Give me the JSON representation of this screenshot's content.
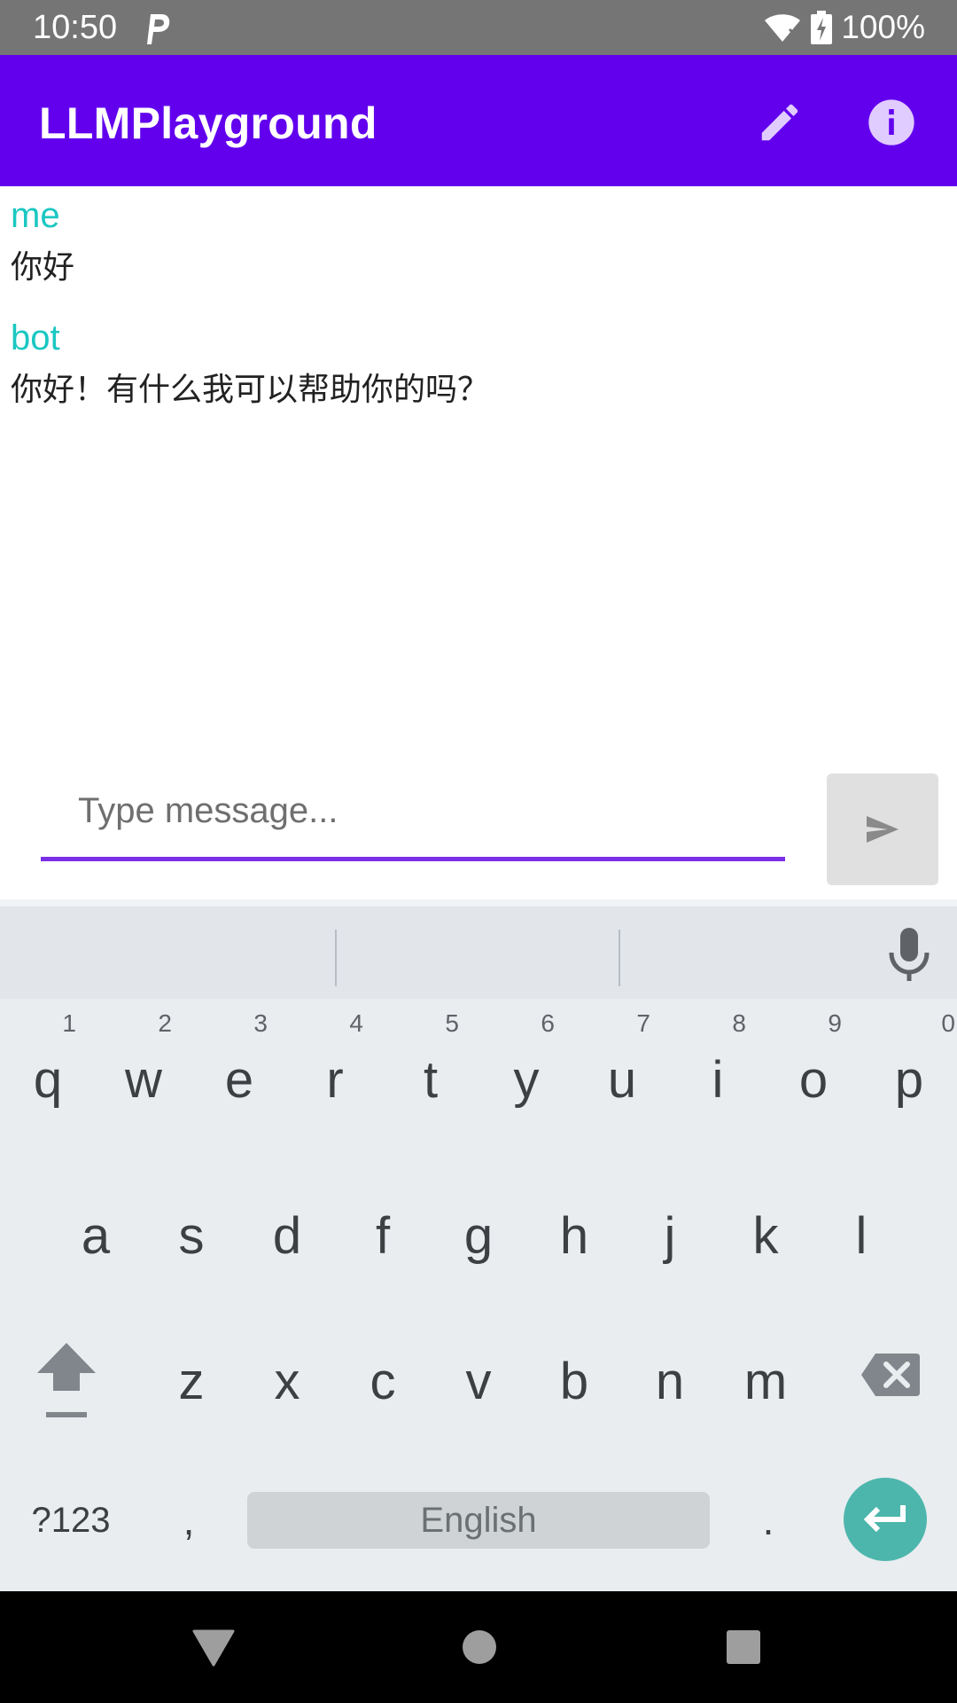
{
  "status_bar": {
    "time": "10:50",
    "battery": "100%"
  },
  "app_bar": {
    "title": "LLMPlayground"
  },
  "chat": {
    "messages": [
      {
        "sender": "me",
        "text": "你好"
      },
      {
        "sender": "bot",
        "text": "你好！有什么我可以帮助你的吗？"
      }
    ]
  },
  "input": {
    "placeholder": "Type message..."
  },
  "keyboard": {
    "row1": [
      {
        "key": "q",
        "num": "1"
      },
      {
        "key": "w",
        "num": "2"
      },
      {
        "key": "e",
        "num": "3"
      },
      {
        "key": "r",
        "num": "4"
      },
      {
        "key": "t",
        "num": "5"
      },
      {
        "key": "y",
        "num": "6"
      },
      {
        "key": "u",
        "num": "7"
      },
      {
        "key": "i",
        "num": "8"
      },
      {
        "key": "o",
        "num": "9"
      },
      {
        "key": "p",
        "num": "0"
      }
    ],
    "row2": [
      "a",
      "s",
      "d",
      "f",
      "g",
      "h",
      "j",
      "k",
      "l"
    ],
    "row3": [
      "z",
      "x",
      "c",
      "v",
      "b",
      "n",
      "m"
    ],
    "symbols_label": "?123",
    "comma": ",",
    "space_label": "English",
    "period": "."
  },
  "colors": {
    "app_bar": "#6200ee",
    "sender": "#1bc7c2",
    "accent_underline": "#7a2ee6",
    "enter_key": "#4db6ac"
  }
}
